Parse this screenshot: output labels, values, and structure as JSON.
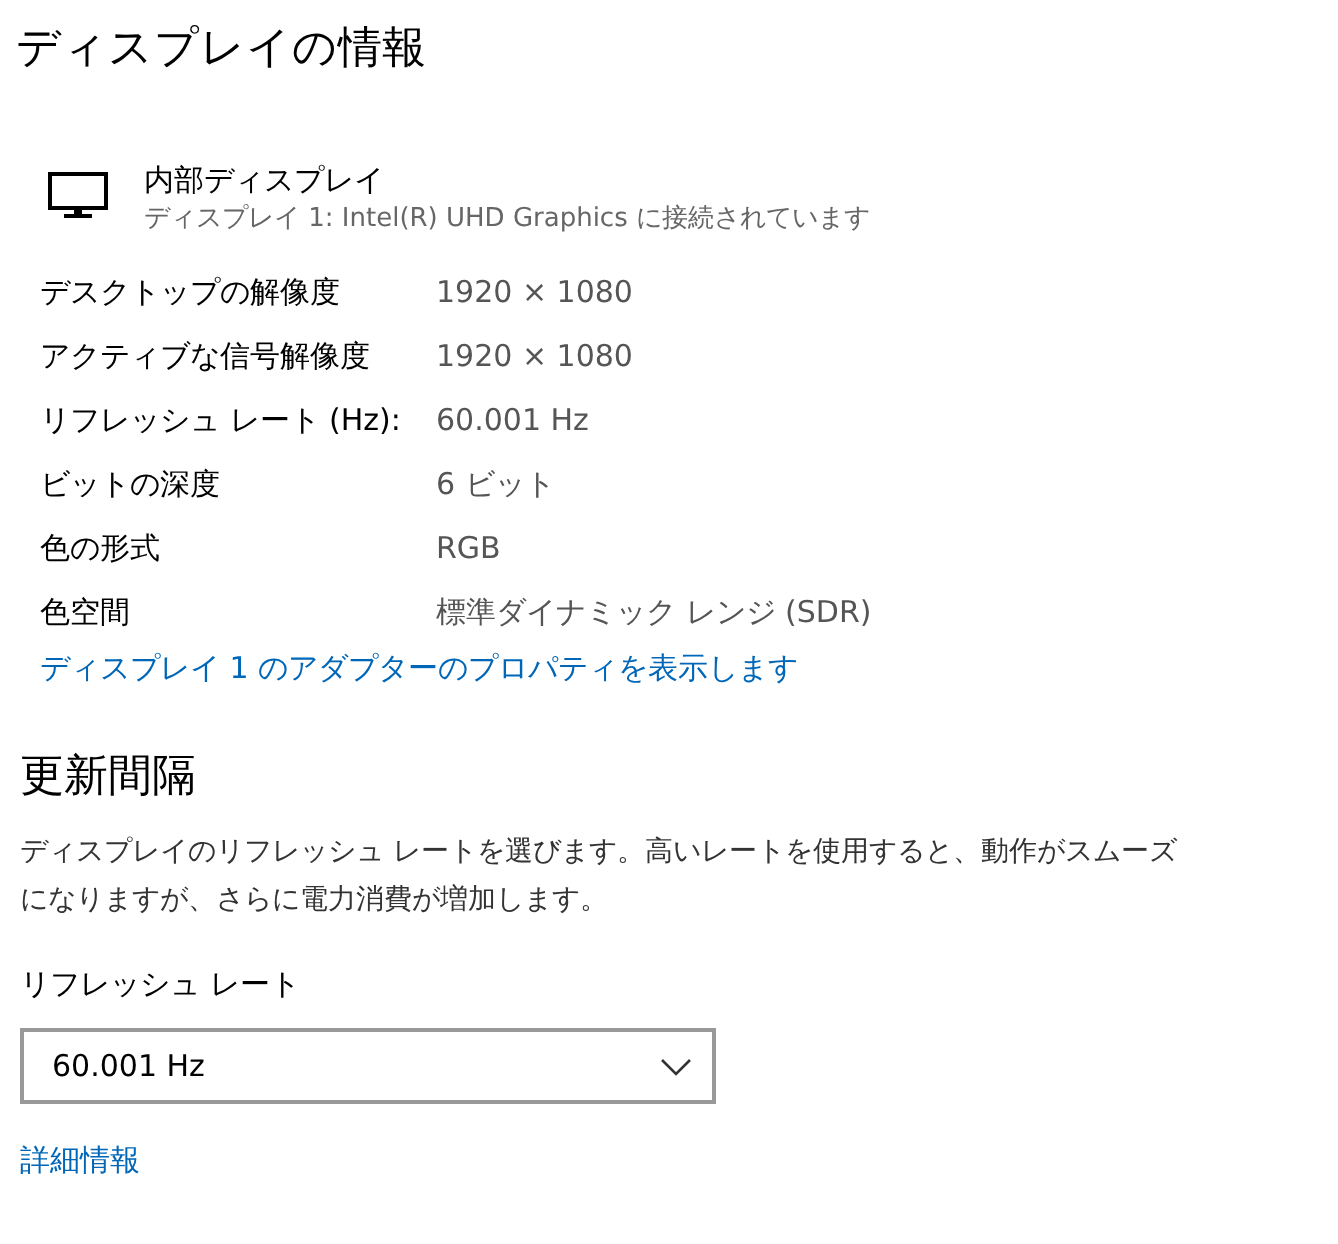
{
  "page_title": "ディスプレイの情報",
  "display": {
    "name": "内部ディスプレイ",
    "description": "ディスプレイ 1: Intel(R) UHD Graphics に接続されています"
  },
  "properties": [
    {
      "label": "デスクトップの解像度",
      "value": "1920 × 1080"
    },
    {
      "label": "アクティブな信号解像度",
      "value": "1920 × 1080"
    },
    {
      "label": "リフレッシュ レート (Hz):",
      "value": "60.001 Hz"
    },
    {
      "label": "ビットの深度",
      "value": "6 ビット"
    },
    {
      "label": "色の形式",
      "value": "RGB"
    },
    {
      "label": "色空間",
      "value": "標準ダイナミック レンジ (SDR)"
    }
  ],
  "adapter_link": "ディスプレイ 1 のアダプターのプロパティを表示します",
  "refresh_section": {
    "heading": "更新間隔",
    "description_lines": [
      "ディスプレイのリフレッシュ レートを選びます。高いレートを使用すると、動作がスムーズ",
      "になりますが、さらに電力消費が増加します。"
    ],
    "field_label": "リフレッシュ レート",
    "dropdown_value": "60.001 Hz"
  },
  "more_info_link": "詳細情報"
}
